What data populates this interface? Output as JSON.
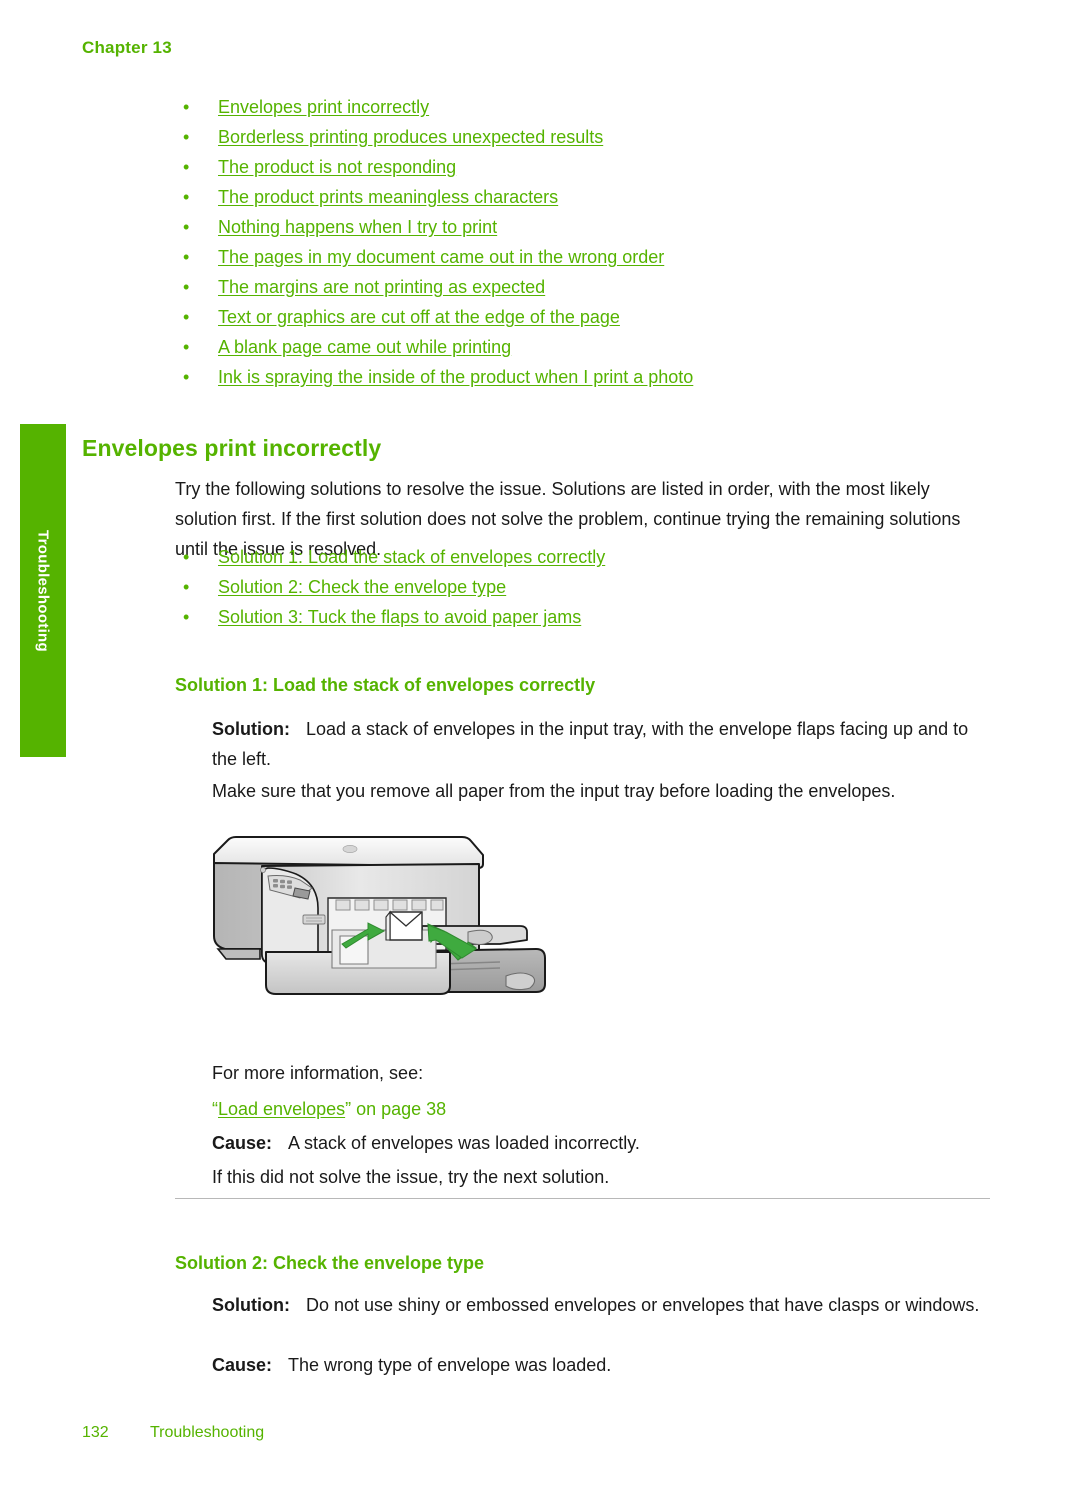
{
  "header": {
    "chapter": "Chapter 13"
  },
  "colors": {
    "accent_green": "#55b300",
    "link_green": "#55b300",
    "body_text": "#1a1a1a",
    "divider": "#b8b8b8"
  },
  "side_tab": {
    "label": "Troubleshooting"
  },
  "top_links": [
    "Envelopes print incorrectly",
    "Borderless printing produces unexpected results",
    "The product is not responding",
    "The product prints meaningless characters",
    "Nothing happens when I try to print",
    "The pages in my document came out in the wrong order",
    "The margins are not printing as expected",
    "Text or graphics are cut off at the edge of the page",
    "A blank page came out while printing",
    "Ink is spraying the inside of the product when I print a photo"
  ],
  "section": {
    "title": "Envelopes print incorrectly",
    "intro": "Try the following solutions to resolve the issue. Solutions are listed in order, with the most likely solution first. If the first solution does not solve the problem, continue trying the remaining solutions until the issue is resolved.",
    "solution_links": [
      "Solution 1: Load the stack of envelopes correctly",
      "Solution 2: Check the envelope type",
      "Solution 3: Tuck the flaps to avoid paper jams"
    ]
  },
  "solution1": {
    "heading": "Solution 1: Load the stack of envelopes correctly",
    "solution_label": "Solution:",
    "solution_text": "Load a stack of envelopes in the input tray, with the envelope flaps facing up and to the left.",
    "note": "Make sure that you remove all paper from the input tray before loading the envelopes.",
    "more_info": "For more information, see:",
    "cross_ref_quote_open": "“",
    "cross_ref_link": "Load envelopes",
    "cross_ref_suffix": "” on page 38",
    "cause_label": "Cause:",
    "cause_text": "A stack of envelopes was loaded incorrectly.",
    "next": "If this did not solve the issue, try the next solution."
  },
  "figure": {
    "name": "hp-all-in-one-printer-load-envelopes-illustration",
    "arrow_color": "#3faa3f",
    "description": "HP All-in-One printer with input tray open, green arrows indicating envelope loading direction"
  },
  "solution2": {
    "heading": "Solution 2: Check the envelope type",
    "solution_label": "Solution:",
    "solution_text": "Do not use shiny or embossed envelopes or envelopes that have clasps or windows.",
    "cause_label": "Cause:",
    "cause_text": "The wrong type of envelope was loaded."
  },
  "footer": {
    "page_number": "132",
    "section_name": "Troubleshooting"
  }
}
